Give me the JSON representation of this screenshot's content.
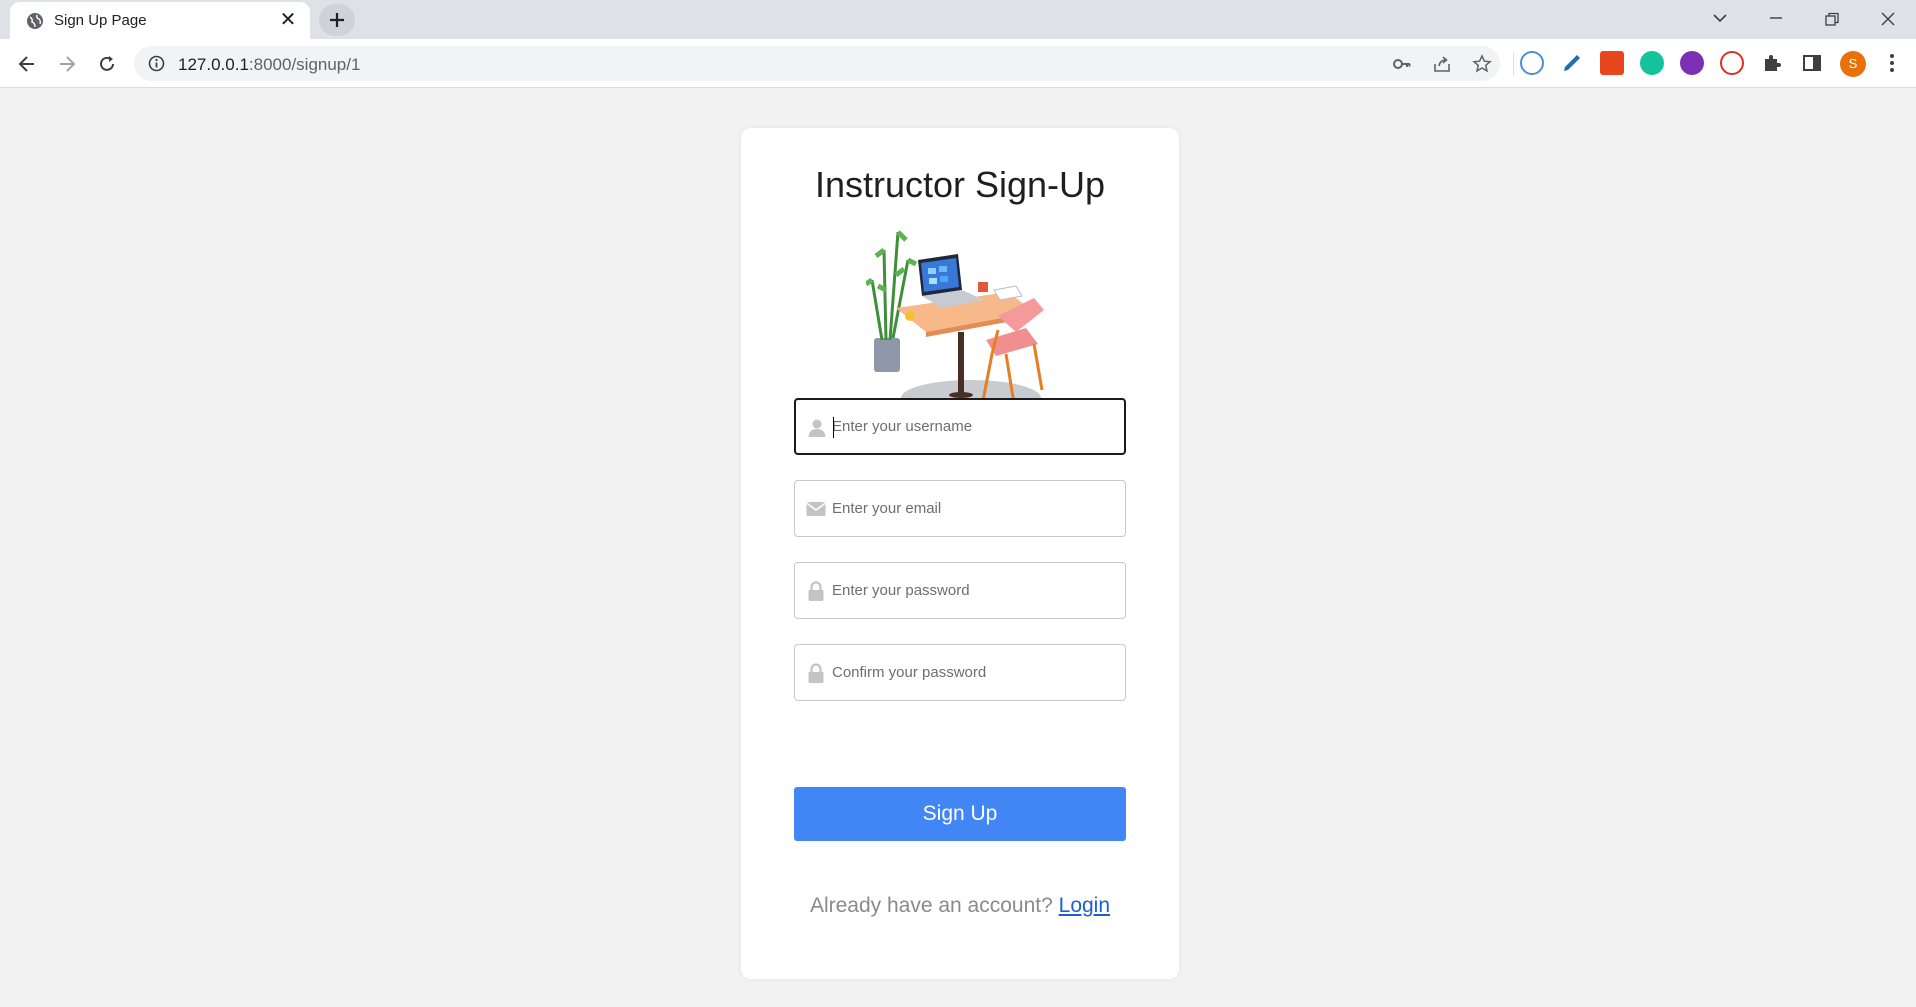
{
  "browser": {
    "tab_title": "Sign Up Page",
    "tab_close": "✕",
    "url_host": "127.0.0.1",
    "url_rest": ":8000/signup/1",
    "avatar_letter": "S"
  },
  "page": {
    "heading": "Instructor Sign-Up",
    "fields": {
      "username_placeholder": "Enter your username",
      "email_placeholder": "Enter your email",
      "password_placeholder": "Enter your password",
      "confirm_placeholder": "Confirm your password"
    },
    "signup_label": "Sign Up",
    "footer_prompt": "Already have an account?",
    "login_link": "Login"
  },
  "colors": {
    "primary_button": "#4285f4",
    "link": "#1a5fd6",
    "page_background": "#f2f2f2"
  }
}
